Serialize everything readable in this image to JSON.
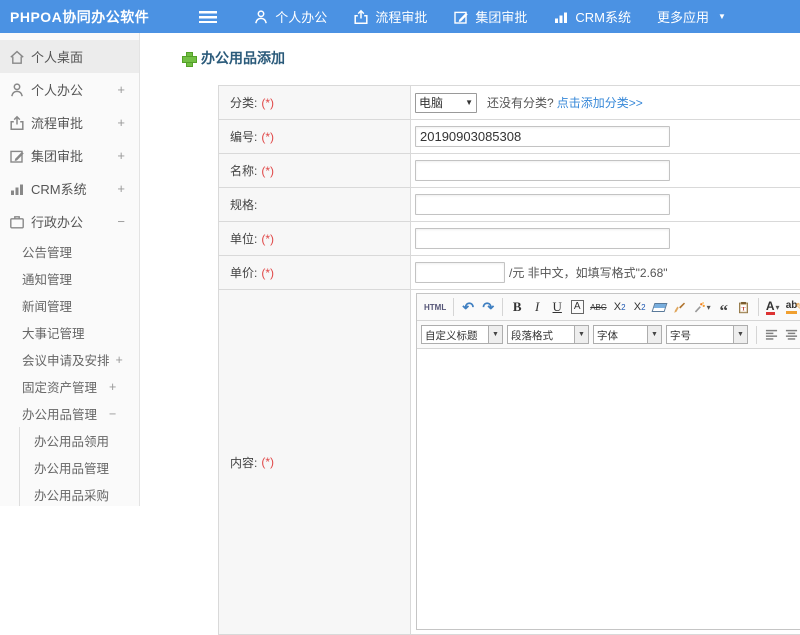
{
  "app": {
    "title": "PHPOA协同办公软件"
  },
  "topnav": {
    "items": [
      {
        "label": "个人办公",
        "icon": "user-icon"
      },
      {
        "label": "流程审批",
        "icon": "upload-icon"
      },
      {
        "label": "集团审批",
        "icon": "edit-icon"
      },
      {
        "label": "CRM系统",
        "icon": "bar-chart-icon"
      },
      {
        "label": "更多应用",
        "icon": "caret-down-icon"
      }
    ]
  },
  "sidebar": {
    "items": [
      {
        "label": "个人桌面",
        "icon": "home-icon",
        "active": true
      },
      {
        "label": "个人办公",
        "icon": "user-icon",
        "expander": "+"
      },
      {
        "label": "流程审批",
        "icon": "upload-icon",
        "expander": "+"
      },
      {
        "label": "集团审批",
        "icon": "edit-icon",
        "expander": "+"
      },
      {
        "label": "CRM系统",
        "icon": "bar-chart-icon",
        "expander": "+"
      },
      {
        "label": "行政办公",
        "icon": "briefcase-icon",
        "expander": "−"
      },
      {
        "label": "公告管理"
      },
      {
        "label": "通知管理"
      },
      {
        "label": "新闻管理"
      },
      {
        "label": "大事记管理"
      },
      {
        "label": "会议申请及安排",
        "expander": "+"
      },
      {
        "label": "固定资产管理",
        "expander": "+"
      },
      {
        "label": "办公用品管理",
        "expander": "−"
      },
      {
        "label": "办公用品领用"
      },
      {
        "label": "办公用品管理"
      },
      {
        "label": "办公用品采购"
      }
    ]
  },
  "page": {
    "title": "办公用品添加"
  },
  "form": {
    "category": {
      "label": "分类:",
      "required": "(*)",
      "selected": "电脑",
      "hint": "还没有分类?",
      "link": "点击添加分类>>"
    },
    "code": {
      "label": "编号:",
      "required": "(*)",
      "value": "20190903085308"
    },
    "name": {
      "label": "名称:",
      "required": "(*)"
    },
    "spec": {
      "label": "规格:"
    },
    "unit": {
      "label": "单位:",
      "required": "(*)"
    },
    "price": {
      "label": "单价:",
      "required": "(*)",
      "suffix": "/元 非中文，如填写格式\"2.68\""
    },
    "content": {
      "label": "内容:",
      "required": "(*)"
    }
  },
  "editor": {
    "html_label": "HTML",
    "bold": "B",
    "italic": "I",
    "underline": "U",
    "fontbox": "A",
    "strike": "ABC",
    "sup_base": "X",
    "sup_mark": "2",
    "sub_base": "X",
    "sub_mark": "2",
    "quote": "“",
    "font_color": "A",
    "highlight": "ab",
    "pencil": "✎",
    "selects": [
      {
        "label": "自定义标题"
      },
      {
        "label": "段落格式"
      },
      {
        "label": "字体"
      },
      {
        "label": "字号"
      }
    ]
  },
  "colors": {
    "header_blue": "#4b92e3",
    "accent_green": "#72bf44",
    "link_blue": "#3788d8",
    "required_red": "#e04848"
  }
}
